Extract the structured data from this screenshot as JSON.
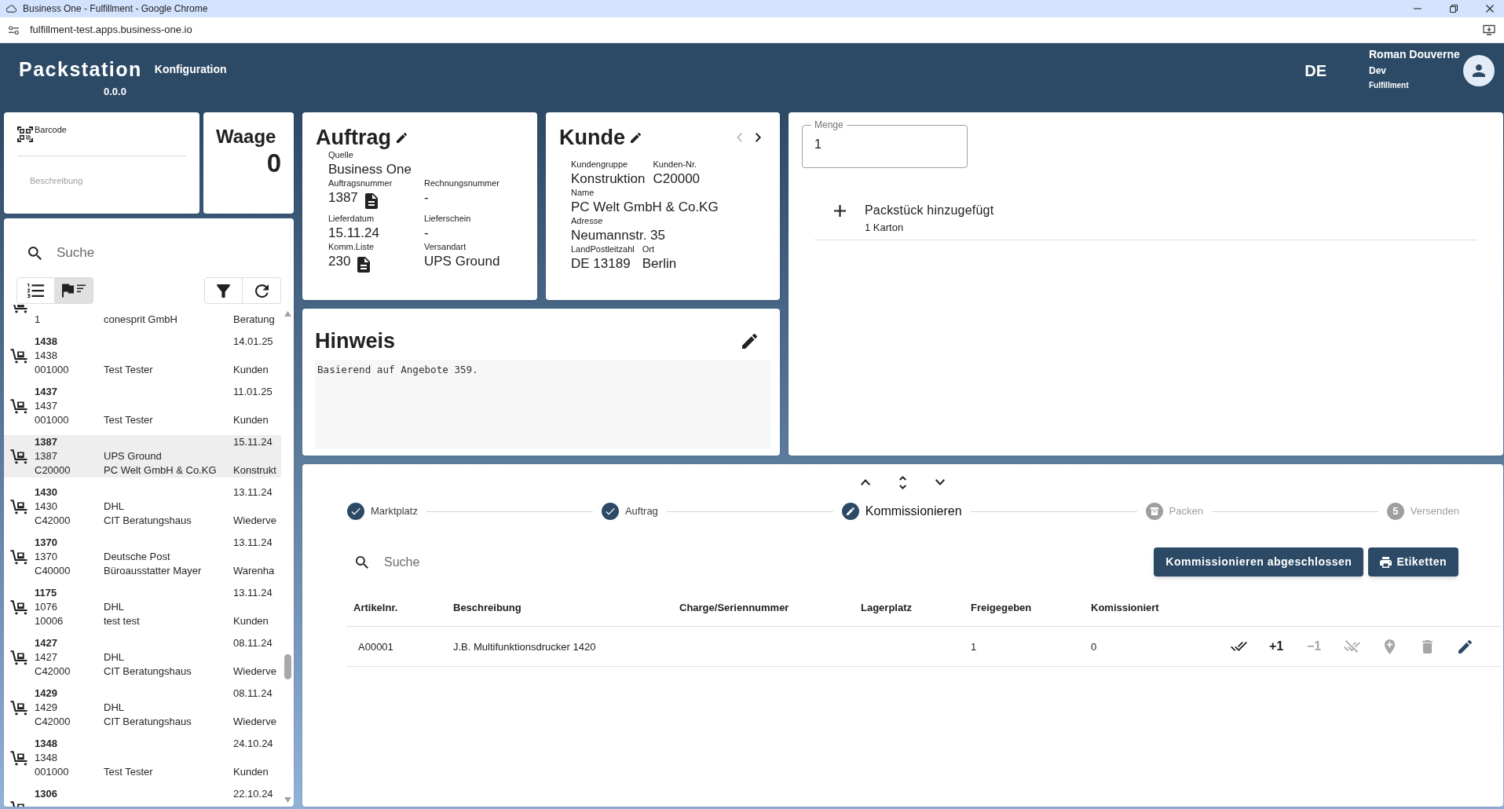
{
  "browser": {
    "title": "Business One - Fulfillment - Google Chrome",
    "url": "fulfillment-test.apps.business-one.io"
  },
  "header": {
    "title": "Packstation",
    "link": "Konfiguration",
    "version": "0.0.0",
    "language": "DE",
    "user": {
      "name": "Roman Douverne",
      "role": "Dev",
      "department": "Fulfillment"
    }
  },
  "barcode": {
    "label": "Barcode",
    "description": "Beschreibung"
  },
  "scale": {
    "title": "Waage",
    "value": "0"
  },
  "order_list": {
    "search": {
      "placeholder": "Suche"
    },
    "views": [
      {
        "kind": "numbered",
        "selected": false
      },
      {
        "kind": "flagged",
        "selected": true
      }
    ],
    "rows": [
      {
        "customer_no": "1",
        "customer": "conesprit GmbH",
        "group": "Beratung",
        "selected": false
      },
      {
        "number": "1438",
        "date": "14.01.25",
        "document": "1438",
        "customer_no": "001000",
        "customer": "Test Tester",
        "group": "Kunden",
        "selected": false
      },
      {
        "number": "1437",
        "date": "11.01.25",
        "document": "1437",
        "customer_no": "001000",
        "customer": "Test Tester",
        "group": "Kunden",
        "selected": false
      },
      {
        "number": "1387",
        "date": "15.11.24",
        "document": "1387",
        "shipping": "UPS Ground",
        "customer_no": "C20000",
        "customer": "PC Welt GmbH & Co.KG",
        "group": "Konstrukt",
        "selected": true
      },
      {
        "number": "1430",
        "date": "13.11.24",
        "document": "1430",
        "shipping": "DHL",
        "customer_no": "C42000",
        "customer": "CIT Beratungshaus",
        "group": "Wiederve",
        "selected": false
      },
      {
        "number": "1370",
        "date": "13.11.24",
        "document": "1370",
        "shipping": "Deutsche Post",
        "customer_no": "C40000",
        "customer": "Büroausstatter Mayer",
        "group": "Warenha",
        "selected": false
      },
      {
        "number": "1175",
        "date": "13.11.24",
        "document": "1076",
        "shipping": "DHL",
        "customer_no": "10006",
        "customer": "test test",
        "group": "Kunden",
        "selected": false
      },
      {
        "number": "1427",
        "date": "08.11.24",
        "document": "1427",
        "shipping": "DHL",
        "customer_no": "C42000",
        "customer": "CIT Beratungshaus",
        "group": "Wiederve",
        "selected": false
      },
      {
        "number": "1429",
        "date": "08.11.24",
        "document": "1429",
        "shipping": "DHL",
        "customer_no": "C42000",
        "customer": "CIT Beratungshaus",
        "group": "Wiederve",
        "selected": false
      },
      {
        "number": "1348",
        "date": "24.10.24",
        "document": "1348",
        "customer_no": "001000",
        "customer": "Test Tester",
        "group": "Kunden",
        "selected": false
      },
      {
        "number": "1306",
        "date": "22.10.24",
        "selected": false
      }
    ]
  },
  "order": {
    "title": "Auftrag",
    "rows": [
      [
        {
          "label": "Quelle",
          "value": "Business One"
        }
      ],
      [
        {
          "label": "Auftragsnummer",
          "value": "1387",
          "document": true
        },
        {
          "label": "Rechnungsnummer",
          "value": "-"
        }
      ],
      [
        {
          "label": "Lieferdatum",
          "value": "15.11.24"
        },
        {
          "label": "Lieferschein",
          "value": "-"
        }
      ],
      [
        {
          "label": "Komm.Liste",
          "value": "230",
          "document": true
        },
        {
          "label": "Versandart",
          "value": "UPS Ground"
        }
      ]
    ]
  },
  "customer": {
    "title": "Kunde",
    "nav": [
      {
        "kind": "previous",
        "disabled": true
      },
      {
        "kind": "next",
        "disabled": false
      }
    ],
    "rows": [
      [
        {
          "label": "Kundengruppe",
          "value": "Konstruktion"
        },
        {
          "label": "Kunden-Nr.",
          "value": "C20000"
        }
      ],
      [
        {
          "label": "Name",
          "value": "PC Welt GmbH & Co.KG"
        }
      ],
      [
        {
          "label": "Adresse",
          "value": "Neumannstr. 35"
        }
      ],
      [
        {
          "label": "LandPostleitzahl",
          "value": "DE 13189"
        },
        {
          "label": "Ort",
          "value": "Berlin"
        }
      ]
    ]
  },
  "note": {
    "title": "Hinweis",
    "text": "Basierend auf Angebote 359."
  },
  "packages": {
    "quantity": {
      "label": "Menge",
      "value": "1"
    },
    "events": [
      {
        "title": "Packstück hinzugefügt",
        "detail": "1 Karton"
      }
    ]
  },
  "workflow": {
    "steps": [
      {
        "label": "Marktplatz",
        "done": true,
        "selected": false
      },
      {
        "label": "Auftrag",
        "done": true,
        "selected": false
      },
      {
        "label": "Kommissionieren",
        "done": false,
        "selected": true
      },
      {
        "label": "Packen",
        "done": false,
        "selected": false
      },
      {
        "label": "Versenden",
        "done": false,
        "selected": false,
        "number": "5"
      }
    ],
    "search": {
      "placeholder": "Suche"
    },
    "buttons": [
      {
        "label": "Kommissionieren abgeschlossen",
        "kind": "plain"
      },
      {
        "label": "Etiketten",
        "kind": "print"
      }
    ],
    "table": {
      "columns": [
        "Artikelnr.",
        "Beschreibung",
        "Charge/Seriennummer",
        "Lagerplatz",
        "Freigegeben",
        "Komissioniert"
      ],
      "rows": [
        {
          "article_no": "A00001",
          "description": "J.B. Multifunktionsdrucker 1420",
          "released": "1",
          "picked": "0",
          "actions": [
            {
              "kind": "confirm",
              "disabled": false
            },
            {
              "kind": "increment",
              "label": "+1",
              "disabled": false
            },
            {
              "kind": "decrement",
              "label": "−1",
              "disabled": true
            },
            {
              "kind": "reset",
              "disabled": true
            },
            {
              "kind": "location",
              "disabled": true
            },
            {
              "kind": "delete",
              "disabled": true
            },
            {
              "kind": "edit",
              "disabled": false
            }
          ]
        }
      ]
    }
  }
}
